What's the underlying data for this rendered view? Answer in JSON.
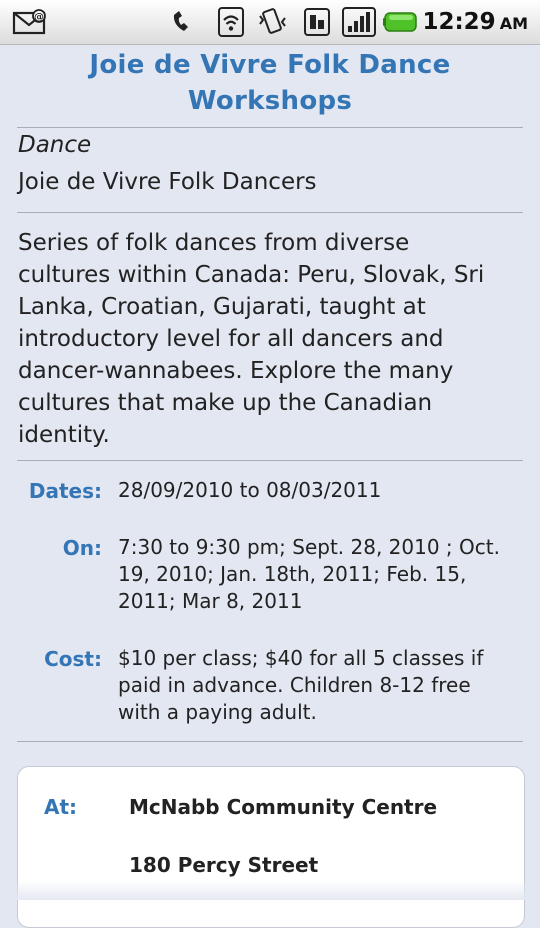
{
  "status_bar": {
    "time": "12:29",
    "ampm": "AM",
    "icons": [
      "email-notification-icon",
      "voicemail-icon",
      "wifi-icon",
      "vibrate-icon",
      "data-icon",
      "signal-icon",
      "battery-icon"
    ]
  },
  "event": {
    "title": "Joie de Vivre Folk Dance Workshops",
    "category": "Dance",
    "organizer": "Joie de Vivre Folk Dancers",
    "description": "Series of folk dances from diverse cultures within Canada: Peru, Slovak, Sri Lanka, Croatian, Gujarati, taught at introductory level for all dancers and dancer-wannabees. Explore the many cultures that make up the Canadian identity."
  },
  "details": {
    "dates_label": "Dates:",
    "dates_value": "28/09/2010 to 08/03/2011",
    "on_label": "On:",
    "on_value": "7:30 to 9:30 pm; Sept. 28, 2010 ; Oct. 19, 2010; Jan. 18th, 2011; Feb. 15, 2011; Mar 8, 2011",
    "cost_label": "Cost:",
    "cost_value": "$10 per class; $40 for all 5 classes if paid in advance. Children 8-12 free with a paying adult."
  },
  "location": {
    "at_label": "At:",
    "venue": "McNabb Community Centre",
    "street": "180 Percy Street"
  },
  "colors": {
    "accent": "#3475b5",
    "background": "#e3e7f1",
    "battery": "#4fc22a"
  }
}
